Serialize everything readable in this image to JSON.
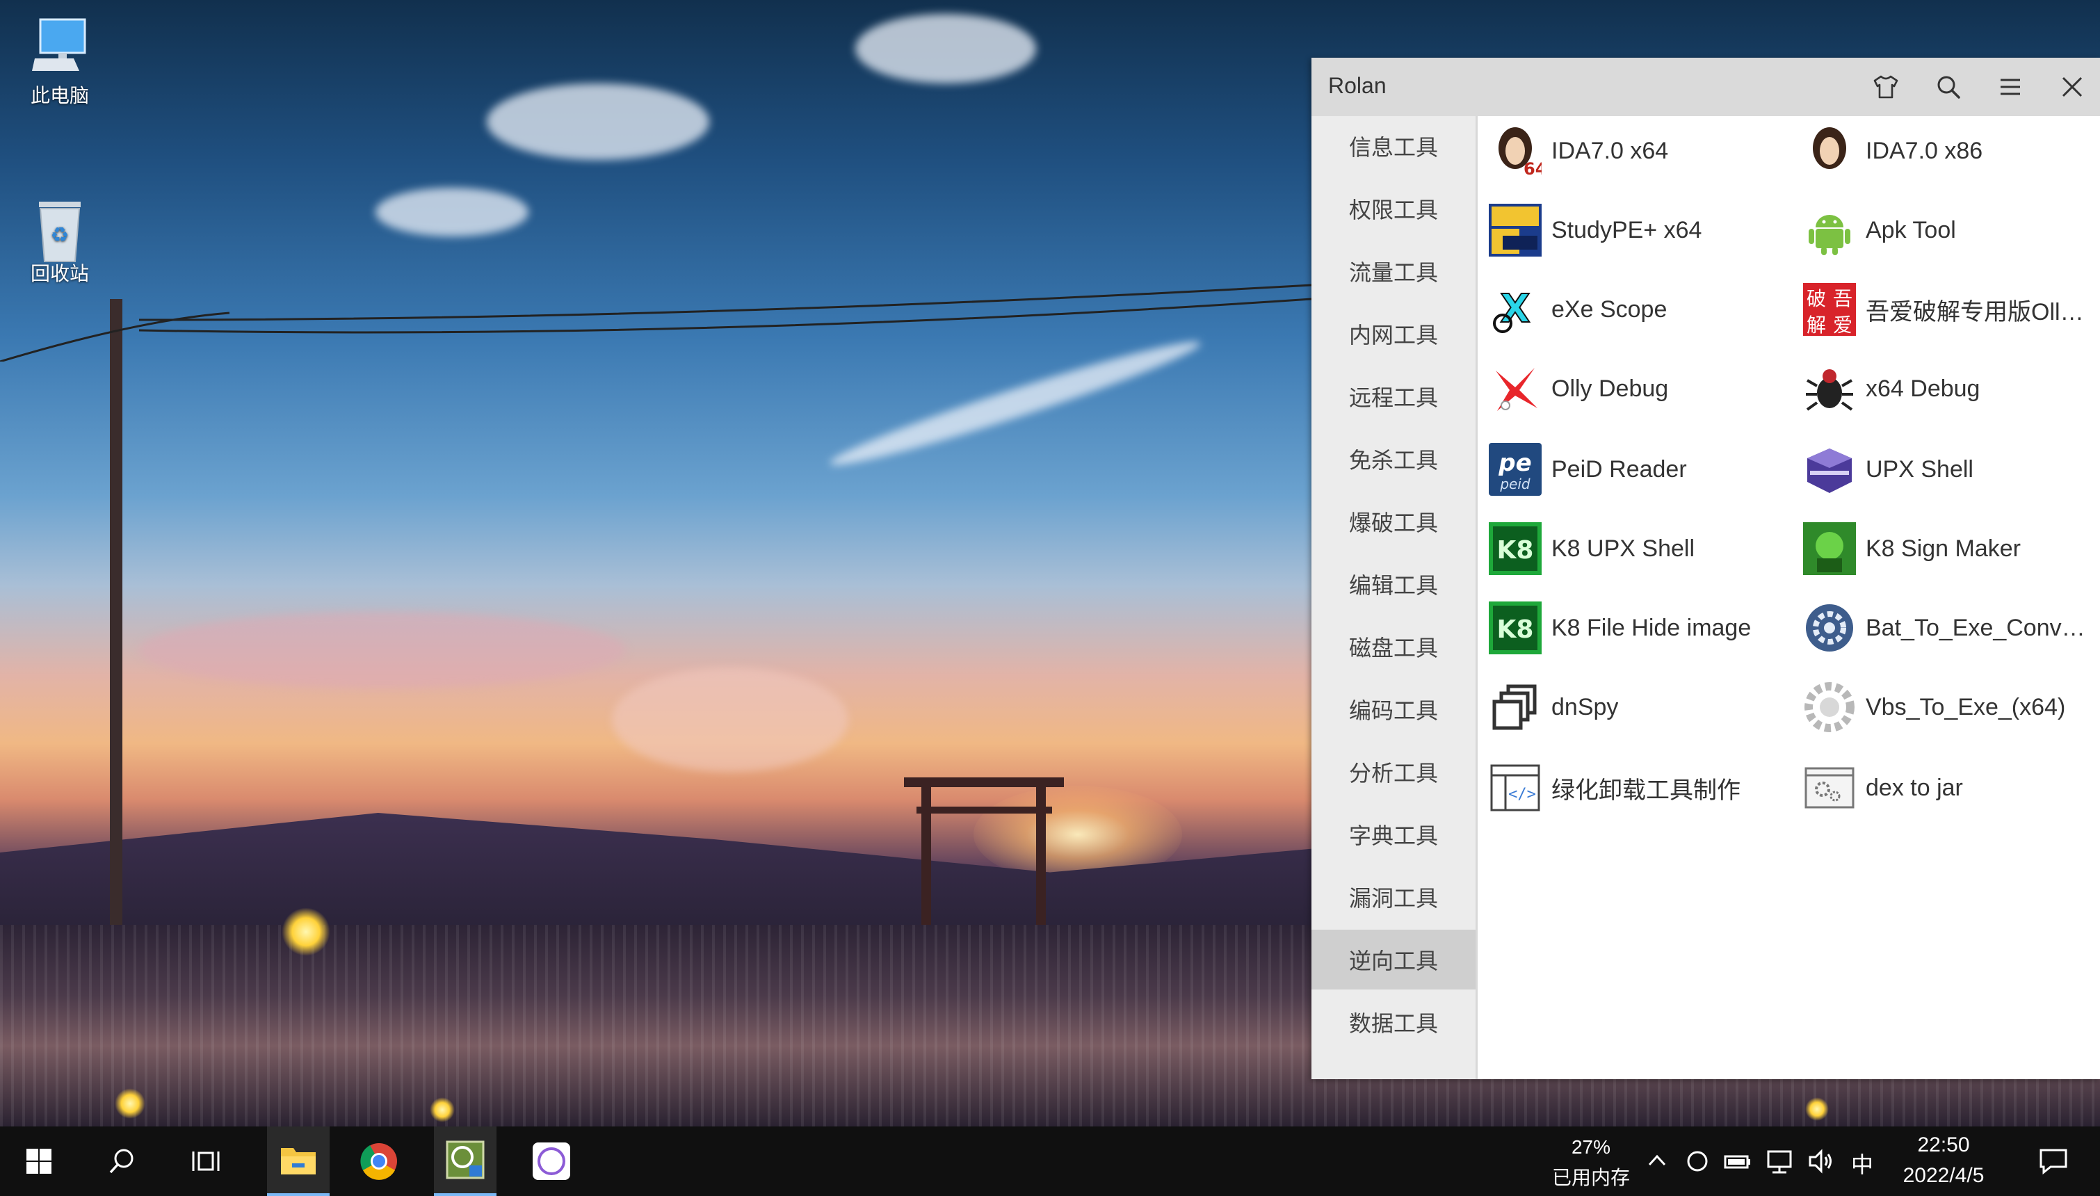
{
  "desktop": {
    "icons": [
      {
        "label": "此电脑",
        "icon": "computer-icon"
      },
      {
        "label": "回收站",
        "icon": "recycle-bin-icon"
      }
    ]
  },
  "window": {
    "title": "Rolan",
    "buttons": [
      "skin-icon",
      "search-icon",
      "menu-icon",
      "close-icon"
    ],
    "sidebar": [
      {
        "label": "信息工具"
      },
      {
        "label": "权限工具"
      },
      {
        "label": "流量工具"
      },
      {
        "label": "内网工具"
      },
      {
        "label": "远程工具"
      },
      {
        "label": "免杀工具"
      },
      {
        "label": "爆破工具"
      },
      {
        "label": "编辑工具"
      },
      {
        "label": "磁盘工具"
      },
      {
        "label": "编码工具"
      },
      {
        "label": "分析工具"
      },
      {
        "label": "字典工具"
      },
      {
        "label": "漏洞工具"
      },
      {
        "label": "逆向工具",
        "active": true
      },
      {
        "label": "数据工具"
      }
    ],
    "apps": [
      {
        "label": "IDA7.0 x64",
        "icon": "ida-icon"
      },
      {
        "label": "IDA7.0 x86",
        "icon": "ida-icon"
      },
      {
        "label": "StudyPE+ x64",
        "icon": "studype-icon"
      },
      {
        "label": "Apk Tool",
        "icon": "android-icon"
      },
      {
        "label": "eXe Scope",
        "icon": "exescope-icon"
      },
      {
        "label": "吾爱破解专用版Olly...",
        "icon": "52pojie-icon"
      },
      {
        "label": "Olly Debug",
        "icon": "ollydbg-icon"
      },
      {
        "label": "x64 Debug",
        "icon": "x64dbg-bug-icon"
      },
      {
        "label": "PeiD Reader",
        "icon": "peid-icon"
      },
      {
        "label": "UPX Shell",
        "icon": "upx-icon"
      },
      {
        "label": "K8 UPX Shell",
        "icon": "k8-icon"
      },
      {
        "label": "K8 Sign Maker",
        "icon": "k8-sign-icon"
      },
      {
        "label": "K8 File Hide image",
        "icon": "k8-icon"
      },
      {
        "label": "Bat_To_Exe_Conver...",
        "icon": "gear-icon"
      },
      {
        "label": "dnSpy",
        "icon": "dnspy-icon"
      },
      {
        "label": "Vbs_To_Exe_(x64)",
        "icon": "gear-icon"
      },
      {
        "label": "绿化卸载工具制作",
        "icon": "code-window-icon"
      },
      {
        "label": "dex to jar",
        "icon": "settings-window-icon"
      }
    ]
  },
  "taskbar": {
    "pinned": [
      "start-icon",
      "search-icon",
      "task-view-icon",
      "file-explorer-icon",
      "chrome-icon",
      "rolan-icon",
      "circle-app-icon"
    ],
    "memory_percent": "27%",
    "memory_label": "已用内存",
    "ime": "中",
    "time": "22:50",
    "date": "2022/4/5"
  }
}
